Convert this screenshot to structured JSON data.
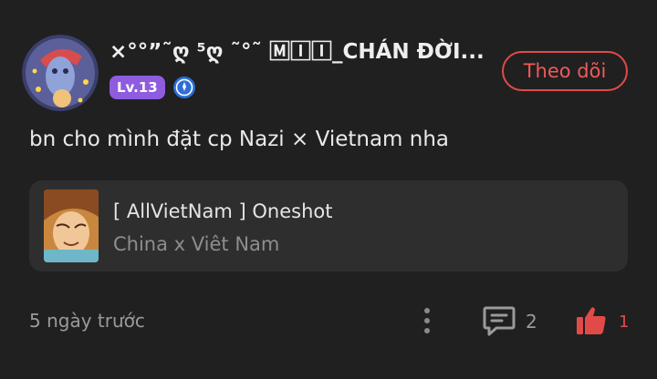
{
  "header": {
    "username": "×°°”˜ღ ⁵ღ ˜°˜ 🄼🄸🄸_CHÁN ĐỜI...",
    "level": "Lv.13",
    "follow_label": "Theo dõi"
  },
  "comment": {
    "text": "bn cho mình đặt cp Nazi × Vietnam nha"
  },
  "story_card": {
    "title": "[ AllVietNam ] Oneshot",
    "subtitle": "China x Viêt Nam"
  },
  "footer": {
    "time": "5 ngày trước",
    "reply_count": "2",
    "like_count": "1"
  },
  "colors": {
    "background": "#202020",
    "accent_red": "#e24a4a",
    "level_badge": "#8f5ce0",
    "card_bg": "#2e2e2e"
  },
  "icons": [
    "avatar",
    "verified-badge-icon",
    "more-options-icon",
    "reply-icon",
    "like-icon"
  ]
}
